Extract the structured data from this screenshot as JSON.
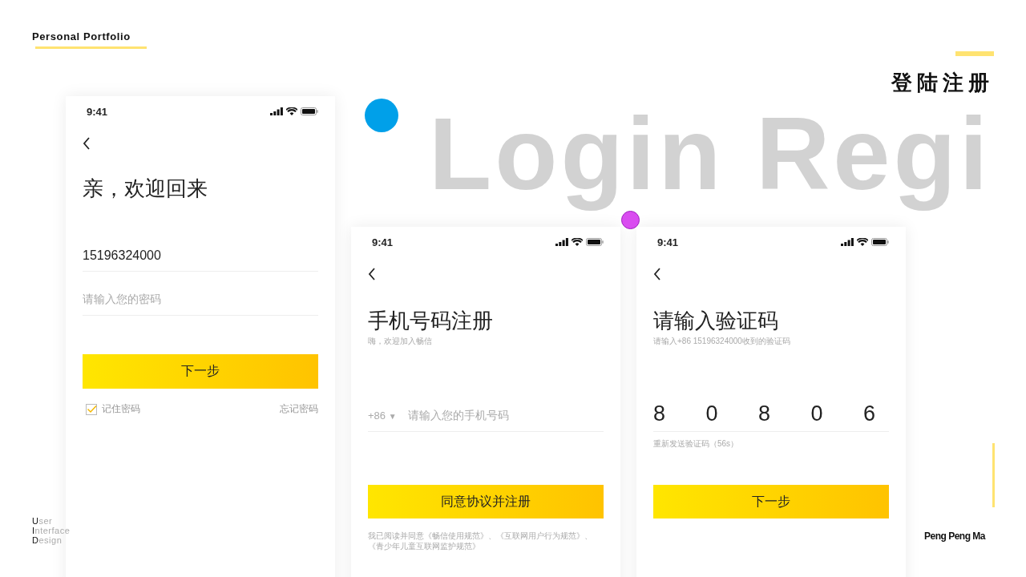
{
  "header": {
    "label": "Personal Portfolio"
  },
  "title": "登陆注册",
  "backdrop_text": "Login Regi",
  "side_caption": [
    {
      "initial": "U",
      "rest": "ser"
    },
    {
      "initial": "I",
      "rest": "nterface"
    },
    {
      "initial": "D",
      "rest": "esign"
    }
  ],
  "author": "Peng Peng Ma",
  "screens": [
    {
      "kind": "login",
      "time": "9:41",
      "heading": "亲，欢迎回来",
      "phone_value": "15196324000",
      "password_placeholder": "请输入您的密码",
      "button": "下一步",
      "remember": {
        "label": "记住密码",
        "checked": true
      },
      "forgot": "忘记密码"
    },
    {
      "kind": "register",
      "time": "9:41",
      "heading": "手机号码注册",
      "subheading": "嗨，欢迎加入畅信",
      "country_code": "+86",
      "country_caret": "▼",
      "phone_placeholder": "请输入您的手机号码",
      "button": "同意协议并注册",
      "agreement": "我已阅读并同意《畅信使用规范》、《互联网用户行为规范》、《青少年儿童互联网监护规范》"
    },
    {
      "kind": "verify",
      "time": "9:41",
      "heading": "请输入验证码",
      "subheading": "请输入+86 15196324000收到的验证码",
      "digits": [
        "8",
        "0",
        "8",
        "0",
        "6"
      ],
      "resend": "重新发送验证码（56s）",
      "button": "下一步"
    }
  ]
}
